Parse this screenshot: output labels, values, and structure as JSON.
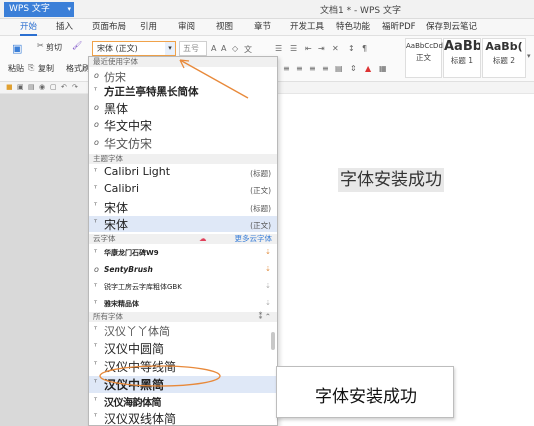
{
  "app": {
    "name": "WPS 文字",
    "window_title": "文档1 * - WPS 文字"
  },
  "menu": [
    "开始",
    "插入",
    "页面布局",
    "引用",
    "审阅",
    "视图",
    "章节",
    "开发工具",
    "特色功能",
    "福昕PDF",
    "保存到云笔记"
  ],
  "toolbar": {
    "cut": "剪切",
    "copy": "复制",
    "paste": "粘贴",
    "format_painter": "格式刷",
    "font_value": "宋体 (正文)",
    "size_value": "五号",
    "styles": [
      {
        "preview": "AaBbCcDd",
        "label": "正文"
      },
      {
        "preview": "AaBb",
        "label": "标题 1"
      },
      {
        "preview": "AaBb(",
        "label": "标题 2"
      }
    ]
  },
  "dropdown": {
    "recent_header": "最近使用字体",
    "recent": [
      {
        "name": "仿宋",
        "icon": "opentype-icon"
      },
      {
        "name": "方正兰亭特黑长简体",
        "icon": "truetype-icon"
      },
      {
        "name": "黑体",
        "icon": "opentype-icon"
      },
      {
        "name": "华文中宋",
        "icon": "opentype-icon"
      },
      {
        "name": "华文仿宋",
        "icon": "opentype-icon"
      }
    ],
    "theme_header": "主题字体",
    "theme": [
      {
        "name": "Calibri Light",
        "tag": "(标题)"
      },
      {
        "name": "Calibri",
        "tag": "(正文)"
      },
      {
        "name": "宋体",
        "tag": "(标题)"
      },
      {
        "name": "宋体",
        "tag": "(正文)"
      }
    ],
    "cloud_header": "云字体",
    "cloud_more": "更多云字体",
    "cloud": [
      {
        "name": "华康龙门石碑W9"
      },
      {
        "name": "SentyBrush"
      },
      {
        "name": "锐字工房云字库粗体GBK"
      },
      {
        "name": "雅宋精品体"
      }
    ],
    "all_header": "所有字体",
    "all": [
      {
        "name": "汉仪丫丫体简"
      },
      {
        "name": "汉仪中圆简"
      },
      {
        "name": "汉仪中等线简"
      },
      {
        "name": "汉仪中黑简"
      },
      {
        "name": "汉仪海韵体简"
      },
      {
        "name": "汉仪双线体简"
      }
    ]
  },
  "document": {
    "sample_text": "字体安装成功",
    "result_text": "字体安装成功"
  },
  "colors": {
    "accent": "#3b7fd8",
    "annotation": "#e8893a"
  }
}
